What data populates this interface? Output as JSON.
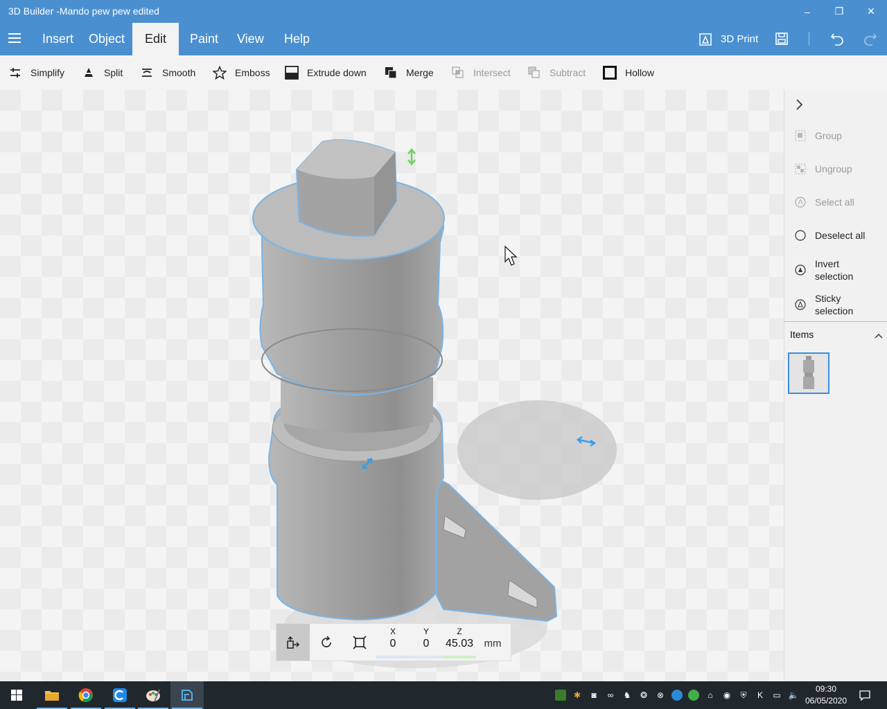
{
  "window": {
    "title": "3D Builder -Mando pew pew edited",
    "min_label": "–",
    "max_label": "❐",
    "close_label": "✕"
  },
  "menu": {
    "items": [
      "Insert",
      "Object",
      "Edit",
      "Paint",
      "View",
      "Help"
    ],
    "active": "Edit",
    "print_label": "3D Print"
  },
  "toolbar": {
    "simplify": "Simplify",
    "split": "Split",
    "smooth": "Smooth",
    "emboss": "Emboss",
    "extrude_down": "Extrude down",
    "merge": "Merge",
    "intersect": "Intersect",
    "subtract": "Subtract",
    "hollow": "Hollow"
  },
  "sidepanel": {
    "group": "Group",
    "ungroup": "Ungroup",
    "select_all": "Select all",
    "deselect_all": "Deselect all",
    "invert_selection_1": "Invert",
    "invert_selection_2": "selection",
    "sticky_selection_1": "Sticky",
    "sticky_selection_2": "selection",
    "items_header": "Items"
  },
  "position": {
    "x_label": "X",
    "x_value": "0",
    "y_label": "Y",
    "y_value": "0",
    "z_label": "Z",
    "z_value": "45.03",
    "unit": "mm"
  },
  "taskbar": {
    "time": "09:30",
    "date": "06/05/2020"
  },
  "colors": {
    "accent": "#4a90d0",
    "selection": "#7ab4e6",
    "taskbar": "#20272d"
  }
}
